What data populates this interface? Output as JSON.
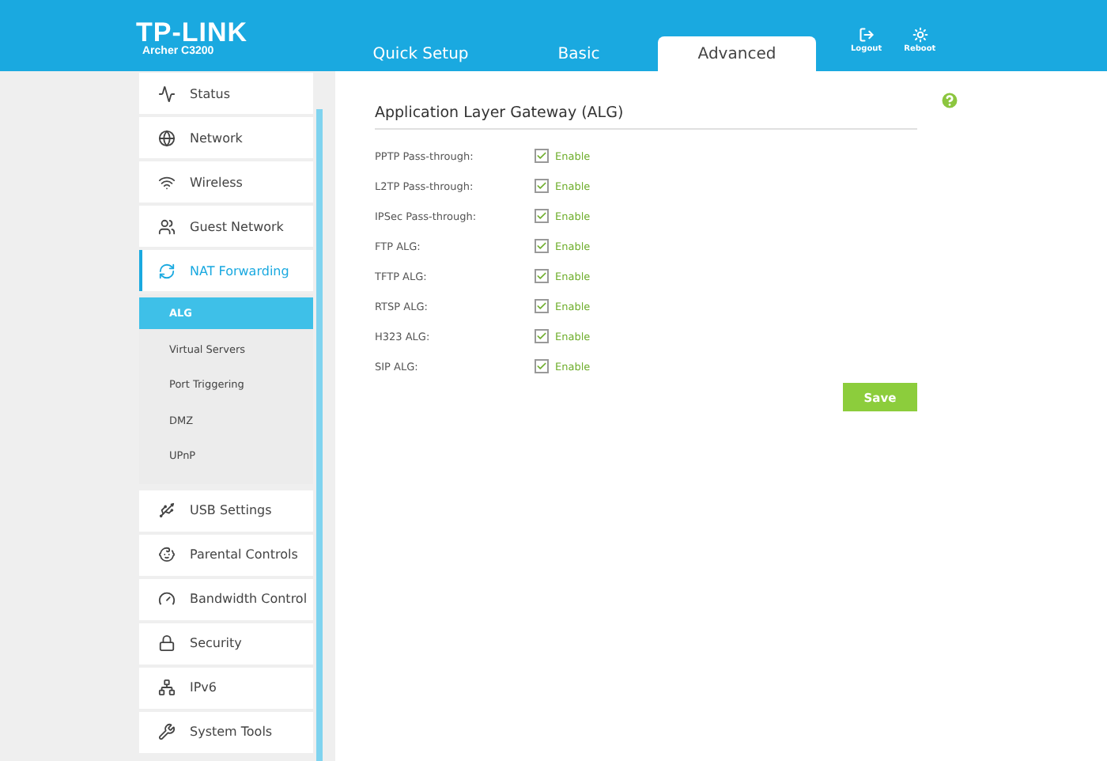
{
  "header": {
    "logo": "TP-LINK",
    "model": "Archer C3200",
    "tabs": [
      {
        "label": "Quick Setup",
        "selected": false
      },
      {
        "label": "Basic",
        "selected": false
      },
      {
        "label": "Advanced",
        "selected": true
      }
    ],
    "actions": [
      {
        "label": "Logout"
      },
      {
        "label": "Reboot"
      }
    ]
  },
  "sidebar": {
    "items": [
      {
        "label": "Status",
        "selected": false
      },
      {
        "label": "Network",
        "selected": false
      },
      {
        "label": "Wireless",
        "selected": false
      },
      {
        "label": "Guest Network",
        "selected": false
      },
      {
        "label": "NAT Forwarding",
        "selected": true,
        "expanded": true,
        "children": [
          {
            "label": "ALG",
            "selected": true
          },
          {
            "label": "Virtual Servers",
            "selected": false
          },
          {
            "label": "Port Triggering",
            "selected": false
          },
          {
            "label": "DMZ",
            "selected": false
          },
          {
            "label": "UPnP",
            "selected": false
          }
        ]
      },
      {
        "label": "USB Settings",
        "selected": false
      },
      {
        "label": "Parental Controls",
        "selected": false
      },
      {
        "label": "Bandwidth Control",
        "selected": false
      },
      {
        "label": "Security",
        "selected": false
      },
      {
        "label": "IPv6",
        "selected": false
      },
      {
        "label": "System Tools",
        "selected": false
      }
    ]
  },
  "panel": {
    "title": "Application Layer Gateway (ALG)",
    "rows": [
      {
        "label": "PPTP Pass-through:",
        "option": "Enable",
        "checked": true
      },
      {
        "label": "L2TP Pass-through:",
        "option": "Enable",
        "checked": true
      },
      {
        "label": "IPSec Pass-through:",
        "option": "Enable",
        "checked": true
      },
      {
        "label": "FTP ALG:",
        "option": "Enable",
        "checked": true
      },
      {
        "label": "TFTP ALG:",
        "option": "Enable",
        "checked": true
      },
      {
        "label": "RTSP ALG:",
        "option": "Enable",
        "checked": true
      },
      {
        "label": "H323 ALG:",
        "option": "Enable",
        "checked": true
      },
      {
        "label": "SIP ALG:",
        "option": "Enable",
        "checked": true
      }
    ],
    "save": "Save"
  }
}
